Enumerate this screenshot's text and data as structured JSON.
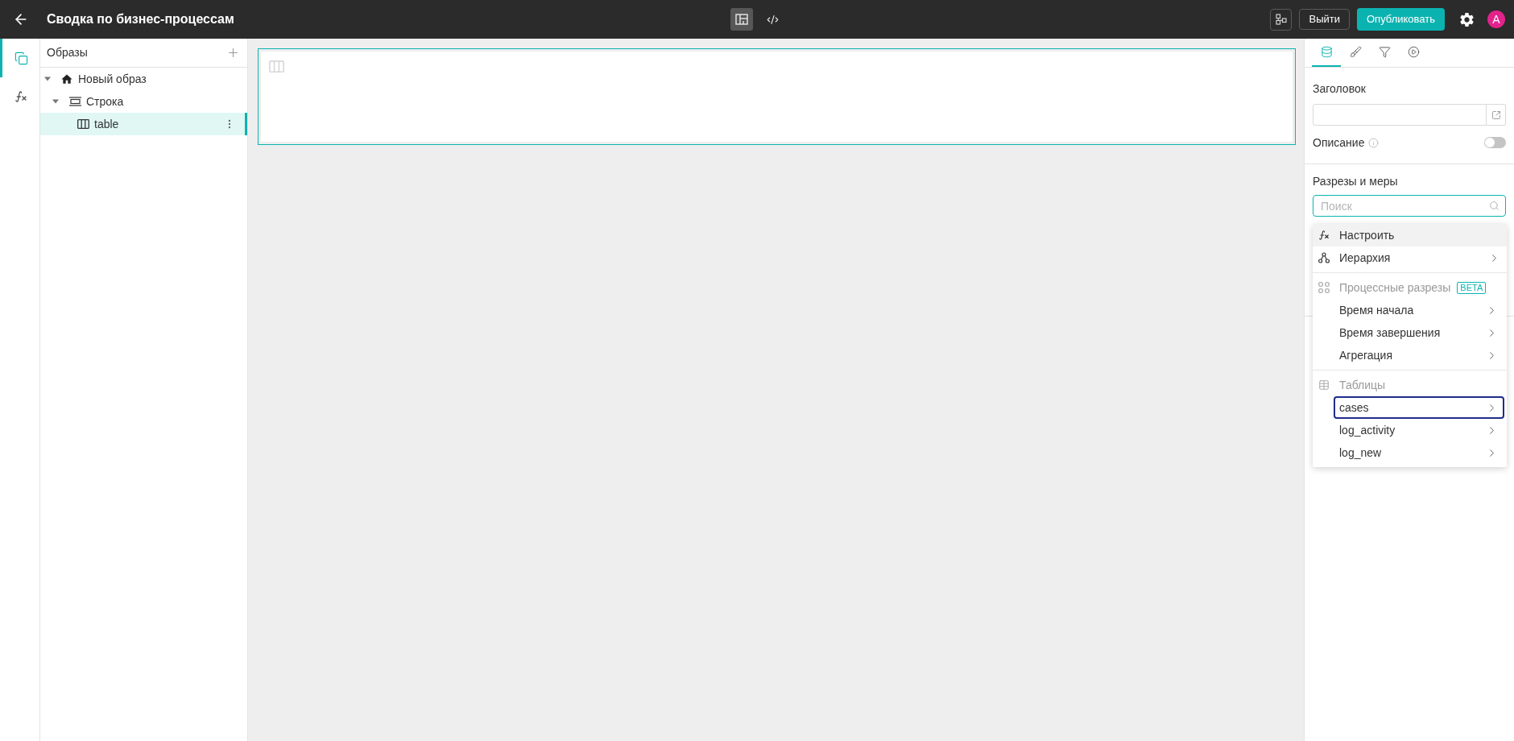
{
  "header": {
    "title": "Сводка по бизнес-процессам",
    "views": [
      {
        "kind": "layout",
        "selected": true
      },
      {
        "kind": "code",
        "selected": false
      }
    ],
    "actions": [
      {
        "kind": "outline",
        "label": "Выйти"
      },
      {
        "kind": "primary",
        "label": "Опубликовать"
      }
    ],
    "avatar": {
      "initial": "A"
    }
  },
  "rail": {
    "items": [
      {
        "kind": "images",
        "selected": true
      },
      {
        "kind": "formulas",
        "selected": false
      }
    ]
  },
  "tree_panel": {
    "title": "Образы",
    "tree": [
      {
        "kind": "home",
        "label": "Новый образ",
        "expanded": true,
        "selected": false,
        "children": [
          {
            "kind": "row",
            "label": "Строка",
            "expanded": true,
            "selected": false,
            "children": [
              {
                "kind": "table",
                "label": "table",
                "selected": true
              }
            ]
          }
        ]
      }
    ]
  },
  "canvas": {
    "widgets": [
      {
        "kind": "table",
        "selected": true
      }
    ]
  },
  "properties": {
    "tabs": [
      {
        "kind": "data",
        "selected": true
      },
      {
        "kind": "style",
        "selected": false
      },
      {
        "kind": "filter",
        "selected": false
      },
      {
        "kind": "actions",
        "selected": false
      }
    ],
    "title_label": "Заголовок",
    "description": {
      "label": "Описание",
      "on": false
    },
    "dimensions_label": "Разрезы и меры",
    "search": {
      "placeholder": "Поиск"
    },
    "menu": {
      "sections": [
        {
          "items": [
            {
              "kind": "formula",
              "label": "Настроить",
              "highlighted": true,
              "focused": false,
              "submenu": false
            },
            {
              "kind": "hierarchy",
              "label": "Иерархия",
              "highlighted": false,
              "focused": false,
              "submenu": true
            }
          ]
        },
        {
          "heading": {
            "kind": "process",
            "label": "Процессные разрезы",
            "badge": "BETA"
          },
          "items": [
            {
              "kind": "plain",
              "label": "Время начала",
              "highlighted": false,
              "focused": false,
              "submenu": true
            },
            {
              "kind": "plain",
              "label": "Время завершения",
              "highlighted": false,
              "focused": false,
              "submenu": true
            },
            {
              "kind": "plain",
              "label": "Агрегация",
              "highlighted": false,
              "focused": false,
              "submenu": true
            }
          ]
        },
        {
          "heading": {
            "kind": "tables",
            "label": "Таблицы"
          },
          "items": [
            {
              "kind": "plain",
              "label": "cases",
              "highlighted": false,
              "focused": true,
              "submenu": true
            },
            {
              "kind": "plain",
              "label": "log_activity",
              "highlighted": false,
              "focused": false,
              "submenu": true
            },
            {
              "kind": "plain",
              "label": "log_new",
              "highlighted": false,
              "focused": false,
              "submenu": true
            }
          ]
        }
      ]
    }
  }
}
